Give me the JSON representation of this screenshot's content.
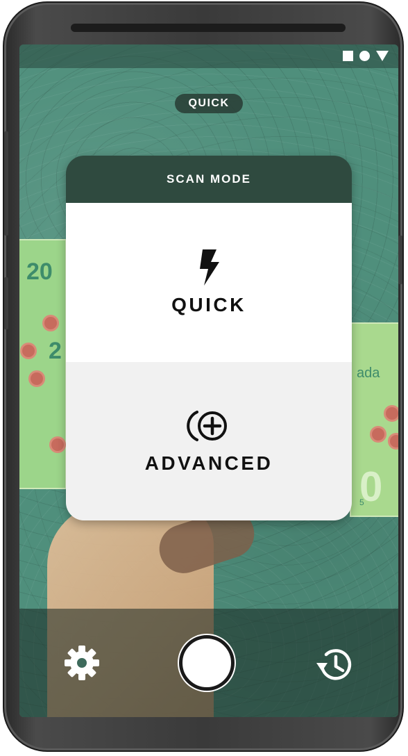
{
  "top_pill": {
    "label": "QUICK"
  },
  "scan_mode_dialog": {
    "title": "SCAN MODE",
    "options": [
      {
        "label": "QUICK",
        "icon": "lightning-bolt-icon"
      },
      {
        "label": "ADVANCED",
        "icon": "advanced-scan-icon"
      }
    ]
  },
  "background_notes": {
    "left_denomination_top": "20",
    "left_denomination_mid": "2",
    "right_text": "ada",
    "right_denomination": "0",
    "right_small": "5"
  },
  "bottom_bar": {
    "settings_icon": "gear-icon",
    "shutter_icon": "shutter-button",
    "history_icon": "history-icon"
  },
  "colors": {
    "background": "#4f8f7c",
    "dialog_header": "#2f4a3f",
    "quick_bg": "#ffffff",
    "advanced_bg": "#f1f1f1",
    "text_dark": "#111111",
    "text_light": "#ffffff"
  }
}
